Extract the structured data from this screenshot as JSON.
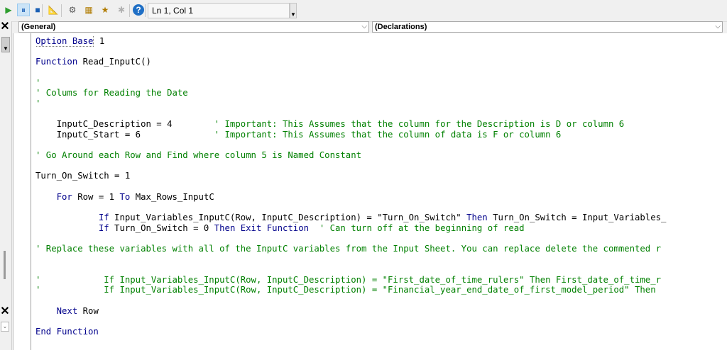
{
  "toolbar": {
    "position_display": "Ln 1, Col 1",
    "buttons": [
      {
        "name": "run-icon",
        "glyph": "▶",
        "color": "#2e9e2e"
      },
      {
        "name": "break-icon",
        "glyph": "⏸",
        "color": "#1a5fb4"
      },
      {
        "name": "reset-icon",
        "glyph": "■",
        "color": "#1a5fb4"
      },
      {
        "name": "design-mode-icon",
        "glyph": "📐",
        "color": "#7a5c00"
      },
      {
        "name": "project-explorer-icon",
        "glyph": "⚙",
        "color": "#555555"
      },
      {
        "name": "properties-window-icon",
        "glyph": "▦",
        "color": "#b07b00"
      },
      {
        "name": "object-browser-icon",
        "glyph": "★",
        "color": "#b07b00"
      },
      {
        "name": "toolbox-icon",
        "glyph": "✱",
        "color": "#b0b0b0"
      },
      {
        "name": "help-icon",
        "glyph": "?",
        "color": "#ffffff"
      }
    ]
  },
  "object_combo": {
    "value": "(General)"
  },
  "procedure_combo": {
    "value": "(Declarations)"
  },
  "colors": {
    "keyword": "#00008b",
    "comment": "#008000",
    "text": "#000000"
  },
  "code_lines": [
    [
      {
        "t": "kw",
        "v": "Option Base"
      },
      {
        "t": "tx",
        "v": " 1"
      }
    ],
    [],
    [
      {
        "t": "kw",
        "v": "Function"
      },
      {
        "t": "tx",
        "v": " Read_InputC()"
      }
    ],
    [],
    [
      {
        "t": "cm",
        "v": "'"
      }
    ],
    [
      {
        "t": "cm",
        "v": "' Colums for Reading the Date"
      }
    ],
    [
      {
        "t": "cm",
        "v": "'"
      }
    ],
    [],
    [
      {
        "t": "tx",
        "v": "    InputC_Description = 4        "
      },
      {
        "t": "cm",
        "v": "' Important: This Assumes that the column for the Description is D or column 6"
      }
    ],
    [
      {
        "t": "tx",
        "v": "    InputC_Start = 6              "
      },
      {
        "t": "cm",
        "v": "' Important: This Assumes that the column of data is F or column 6"
      }
    ],
    [],
    [
      {
        "t": "cm",
        "v": "' Go Around each Row and Find where column 5 is Named Constant"
      }
    ],
    [],
    [
      {
        "t": "tx",
        "v": "Turn_On_Switch = 1"
      }
    ],
    [],
    [
      {
        "t": "tx",
        "v": "    "
      },
      {
        "t": "kw",
        "v": "For"
      },
      {
        "t": "tx",
        "v": " Row = 1 "
      },
      {
        "t": "kw",
        "v": "To"
      },
      {
        "t": "tx",
        "v": " Max_Rows_InputC"
      }
    ],
    [],
    [
      {
        "t": "tx",
        "v": "            "
      },
      {
        "t": "kw",
        "v": "If"
      },
      {
        "t": "tx",
        "v": " Input_Variables_InputC(Row, InputC_Description) = \"Turn_On_Switch\" "
      },
      {
        "t": "kw",
        "v": "Then"
      },
      {
        "t": "tx",
        "v": " Turn_On_Switch = Input_Variables_"
      }
    ],
    [
      {
        "t": "tx",
        "v": "            "
      },
      {
        "t": "kw",
        "v": "If"
      },
      {
        "t": "tx",
        "v": " Turn_On_Switch = 0 "
      },
      {
        "t": "kw",
        "v": "Then Exit Function"
      },
      {
        "t": "tx",
        "v": "  "
      },
      {
        "t": "cm",
        "v": "' Can turn off at the beginning of read"
      }
    ],
    [],
    [
      {
        "t": "cm",
        "v": "' Replace these variables with all of the InputC variables from the Input Sheet. You can replace delete the commented r"
      }
    ],
    [],
    [],
    [
      {
        "t": "cm",
        "v": "'            If Input_Variables_InputC(Row, InputC_Description) = \"First_date_of_time_rulers\" Then First_date_of_time_r"
      }
    ],
    [
      {
        "t": "cm",
        "v": "'            If Input_Variables_InputC(Row, InputC_Description) = \"Financial_year_end_date_of_first_model_period\" Then"
      }
    ],
    [],
    [
      {
        "t": "tx",
        "v": "    "
      },
      {
        "t": "kw",
        "v": "Next"
      },
      {
        "t": "tx",
        "v": " Row"
      }
    ],
    [],
    [
      {
        "t": "kw",
        "v": "End Function"
      }
    ]
  ]
}
